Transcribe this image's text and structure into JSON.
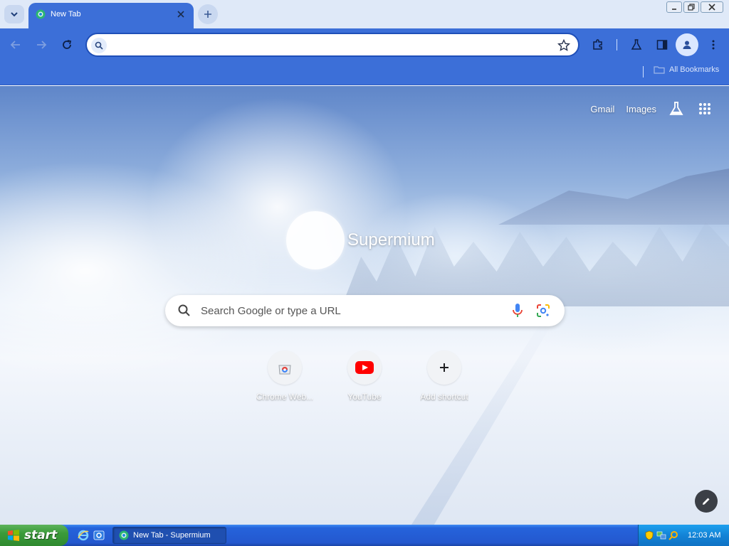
{
  "tab": {
    "title": "New Tab"
  },
  "omnibox": {
    "value": "",
    "placeholder": ""
  },
  "bookmarks": {
    "all_bookmarks": "All Bookmarks"
  },
  "ntp": {
    "links": {
      "gmail": "Gmail",
      "images": "Images"
    },
    "brand": "Supermium",
    "search_placeholder": "Search Google or type a URL",
    "shortcuts": [
      {
        "label": "Chrome Web...",
        "icon": "chrome-web-store-icon"
      },
      {
        "label": "YouTube",
        "icon": "youtube-icon"
      },
      {
        "label": "Add shortcut",
        "icon": "plus-icon"
      }
    ]
  },
  "taskbar": {
    "start_label": "start",
    "task_title": "New Tab - Supermium",
    "clock": "12:03 AM"
  },
  "colors": {
    "toolbar": "#3c6fd8",
    "tabstrip": "#dfe9f8",
    "taskbar": "#2458cf",
    "start_green": "#3b9b3a"
  }
}
